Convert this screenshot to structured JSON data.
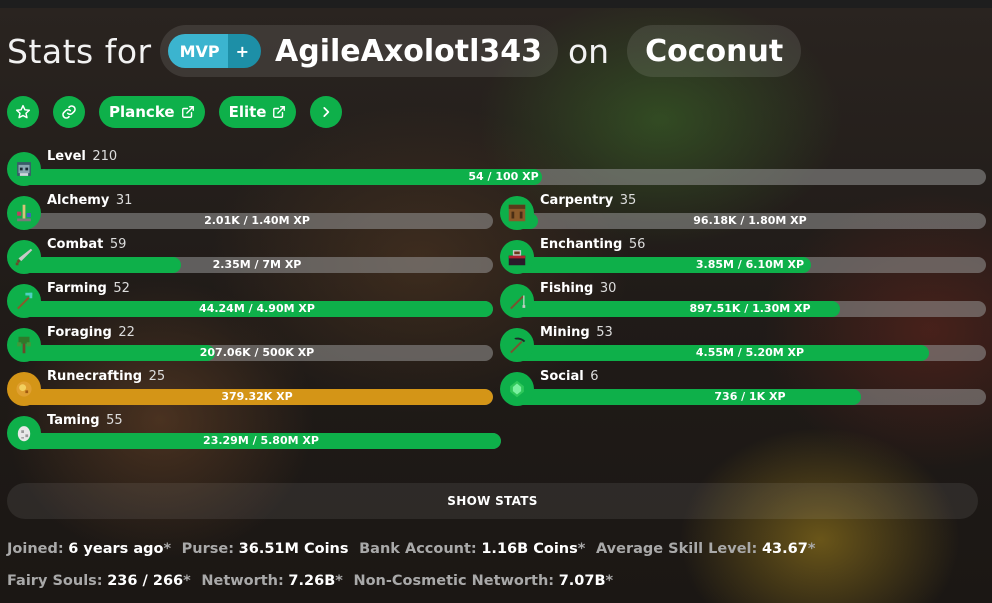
{
  "header": {
    "stats_for": "Stats for",
    "rank_mvp": "MVP",
    "rank_plus": "+",
    "player": "AgileAxolotl343",
    "on": "on",
    "profile": "Coconut"
  },
  "buttons": {
    "plancke": "Plancke",
    "elite": "Elite"
  },
  "level": {
    "name": "Level",
    "value": "210",
    "xp": "54 / 100 XP",
    "progress": 0.54,
    "icon": "wizard-head-icon"
  },
  "skills": [
    {
      "id": "alchemy",
      "name": "Alchemy",
      "level": "31",
      "xp": "2.01K / 1.40M XP",
      "progress": 0.0,
      "icon": "brewing-stand-icon"
    },
    {
      "id": "carpentry",
      "name": "Carpentry",
      "level": "35",
      "xp": "96.18K / 1.80M XP",
      "progress": 0.05,
      "icon": "crafting-table-icon"
    },
    {
      "id": "combat",
      "name": "Combat",
      "level": "59",
      "xp": "2.35M / 7M XP",
      "progress": 0.34,
      "icon": "sword-icon"
    },
    {
      "id": "enchanting",
      "name": "Enchanting",
      "level": "56",
      "xp": "3.85M / 6.10M XP",
      "progress": 0.63,
      "icon": "enchanting-table-icon"
    },
    {
      "id": "farming",
      "name": "Farming",
      "level": "52",
      "xp": "44.24M / 4.90M XP",
      "progress": 1.0,
      "icon": "hoe-icon"
    },
    {
      "id": "fishing",
      "name": "Fishing",
      "level": "30",
      "xp": "897.51K / 1.30M XP",
      "progress": 0.69,
      "icon": "fishing-rod-icon"
    },
    {
      "id": "foraging",
      "name": "Foraging",
      "level": "22",
      "xp": "207.06K / 500K XP",
      "progress": 0.41,
      "icon": "sapling-icon"
    },
    {
      "id": "mining",
      "name": "Mining",
      "level": "53",
      "xp": "4.55M / 5.20M XP",
      "progress": 0.88,
      "icon": "pickaxe-icon"
    },
    {
      "id": "runecrafting",
      "name": "Runecrafting",
      "level": "25",
      "xp": "379.32K XP",
      "progress": 1.0,
      "icon": "magma-cream-icon",
      "maxed": true
    },
    {
      "id": "social",
      "name": "Social",
      "level": "6",
      "xp": "736 / 1K XP",
      "progress": 0.736,
      "icon": "emerald-icon"
    },
    {
      "id": "taming",
      "name": "Taming",
      "level": "55",
      "xp": "23.29M / 5.80M XP",
      "progress": 1.0,
      "icon": "spawn-egg-icon"
    }
  ],
  "show_stats": "SHOW STATS",
  "info1": [
    {
      "key": "Joined:",
      "value": "6 years ago",
      "star": "*"
    },
    {
      "key": "Purse:",
      "value": "36.51M Coins",
      "star": ""
    },
    {
      "key": "Bank Account:",
      "value": "1.16B Coins",
      "star": "*"
    },
    {
      "key": "Average Skill Level:",
      "value": "43.67",
      "star": "*"
    }
  ],
  "info2": [
    {
      "key": "Fairy Souls:",
      "value": "236 / 266",
      "star": "*"
    },
    {
      "key": "Networth:",
      "value": "7.26B",
      "star": "*"
    },
    {
      "key": "Non-Cosmetic Networth:",
      "value": "7.07B",
      "star": "*"
    }
  ],
  "colors": {
    "green": "#0eb04a",
    "gold": "#d49517",
    "mvp": "#3bb4cf",
    "mvp_plus": "#1d8fa7"
  }
}
